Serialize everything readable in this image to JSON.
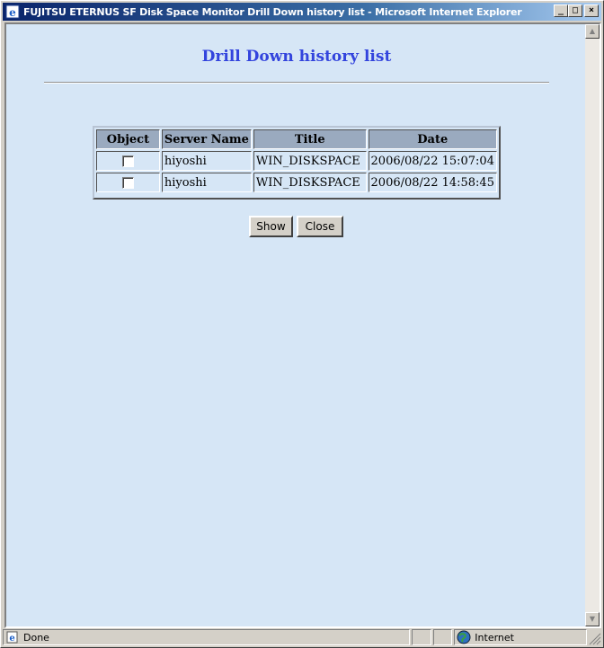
{
  "window": {
    "title": "FUJITSU ETERNUS SF Disk Space Monitor Drill Down history list - Microsoft Internet Explorer",
    "buttons": {
      "minimize": "_",
      "maximize": "□",
      "close": "×"
    }
  },
  "page": {
    "heading": "Drill Down history list",
    "table": {
      "headers": [
        "Object",
        "Server Name",
        "Title",
        "Date"
      ],
      "rows": [
        {
          "checked": false,
          "server": "hiyoshi",
          "title": "WIN_DISKSPACE",
          "date": "2006/08/22 15:07:04"
        },
        {
          "checked": false,
          "server": "hiyoshi",
          "title": "WIN_DISKSPACE",
          "date": "2006/08/22 14:58:45"
        }
      ]
    },
    "buttons": {
      "show": "Show",
      "close": "Close"
    }
  },
  "status": {
    "text": "Done",
    "zone": "Internet"
  },
  "icons": [
    "ie-icon",
    "page-icon",
    "globe-icon"
  ]
}
